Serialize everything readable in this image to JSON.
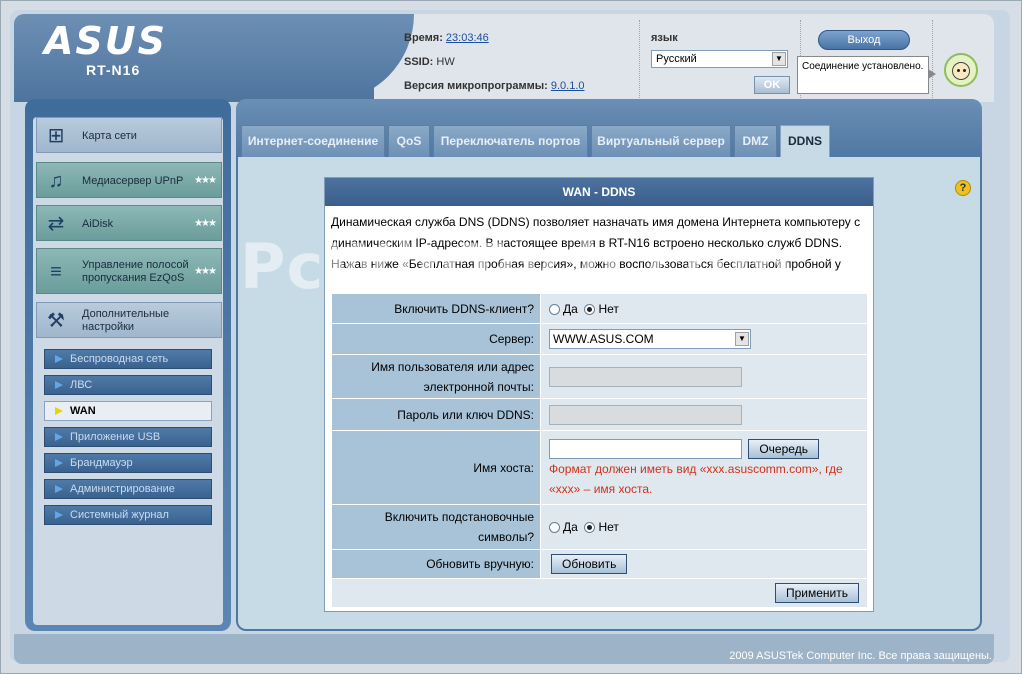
{
  "header": {
    "logo_text": "ASUS",
    "model": "RT-N16",
    "time_label": "Время:",
    "time_value": "23:03:46",
    "ssid_label": "SSID:",
    "ssid_value": "HW",
    "firmware_label": "Версия микропрограммы:",
    "firmware_value": "9.0.1.0",
    "language_label": "язык",
    "language_value": "Русский",
    "ok_label": "OK",
    "logout_label": "Выход",
    "status_text": "Соединение установлено."
  },
  "sidebar": {
    "items": [
      {
        "label": "Карта сети",
        "icon": "network-map-icon"
      },
      {
        "label": "Медиасервер UPnP",
        "icon": "media-server-icon"
      },
      {
        "label": "AiDisk",
        "icon": "aidisk-icon"
      },
      {
        "label": "Управление полосой пропускания EzQoS",
        "icon": "bandwidth-icon"
      },
      {
        "label": "Дополнительные настройки",
        "icon": "tools-icon"
      }
    ],
    "submenu": [
      {
        "label": "Беспроводная сеть"
      },
      {
        "label": "ЛВС"
      },
      {
        "label": "WAN"
      },
      {
        "label": "Приложение USB"
      },
      {
        "label": "Брандмауэр"
      },
      {
        "label": "Администрирование"
      },
      {
        "label": "Системный журнал"
      }
    ]
  },
  "tabs": [
    {
      "label": "Интернет-соединение"
    },
    {
      "label": "QoS"
    },
    {
      "label": "Переключатель портов"
    },
    {
      "label": "Виртуальный сервер"
    },
    {
      "label": "DMZ"
    },
    {
      "label": "DDNS"
    }
  ],
  "panel": {
    "title": "WAN - DDNS",
    "description": "Динамическая служба DNS (DDNS) позволяет назначать имя домена Интернета компьютеру с динамическим IP-адресом. В настоящее время в RT-N16 встроено несколько служб DDNS. Нажав ниже «Бесплатная пробная версия», можно воспользоваться бесплатной пробной у",
    "enable_label": "Включить DDNS-клиент?",
    "yes": "Да",
    "no": "Нет",
    "server_label": "Сервер:",
    "server_value": "WWW.ASUS.COM",
    "username_label": "Имя пользователя или адрес электронной почты:",
    "password_label": "Пароль или ключ DDNS:",
    "hostname_label": "Имя хоста:",
    "hostname_value": "",
    "queue_button": "Очередь",
    "hostname_hint": "Формат должен иметь вид «xxx.asuscomm.com», где «xxx» – имя хоста.",
    "wildcard_label": "Включить подстановочные символы?",
    "manual_update_label": "Обновить вручную:",
    "update_button": "Обновить",
    "apply_button": "Применить"
  },
  "watermark": "PcWinTech.com",
  "footer": "2009 ASUSTek Computer Inc. Все права защищены."
}
